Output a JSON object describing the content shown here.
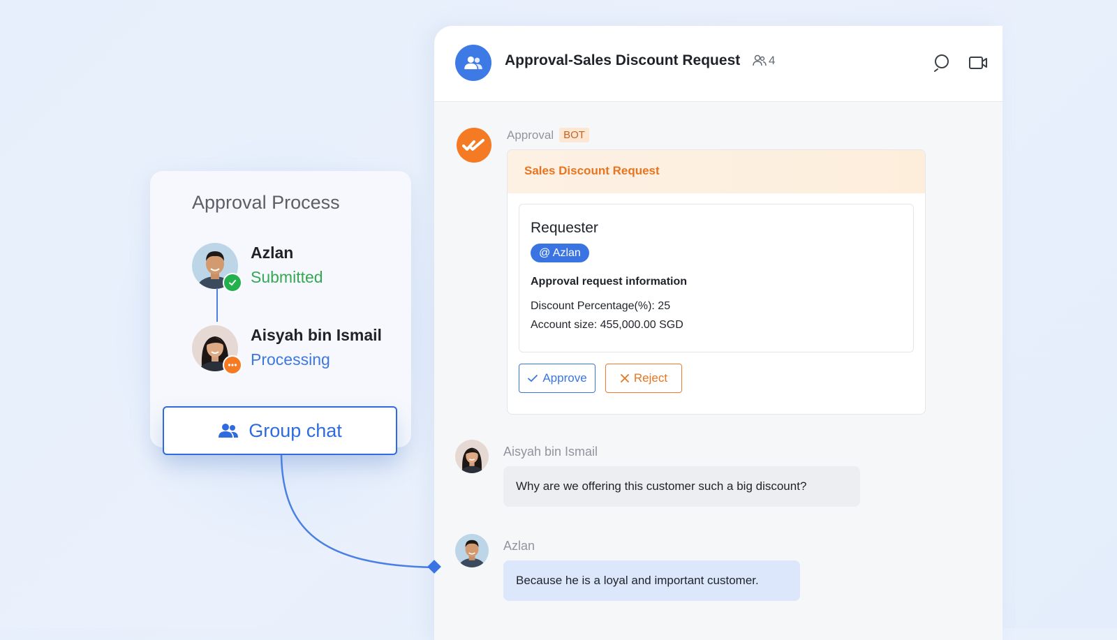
{
  "process": {
    "title": "Approval Process",
    "steps": [
      {
        "name": "Azlan",
        "status": "Submitted",
        "status_color": "#34a853",
        "badge_icon": "check-icon"
      },
      {
        "name": "Aisyah bin Ismail",
        "status": "Processing",
        "status_color": "#3c78e0",
        "badge_icon": "more-dots-icon"
      }
    ],
    "group_chat_label": "Group chat"
  },
  "chat": {
    "title": "Approval-Sales Discount Request",
    "member_count": "4",
    "bot": {
      "sender": "Approval",
      "badge": "BOT",
      "card": {
        "title": "Sales Discount Request",
        "requester_label": "Requester",
        "requester_mention": "@ Azlan",
        "info_heading": "Approval request information",
        "info_lines": [
          "Discount Percentage(%): 25",
          "Account size: 455,000.00 SGD"
        ],
        "approve_label": "Approve",
        "reject_label": "Reject"
      }
    },
    "messages": [
      {
        "sender": "Aisyah bin Ismail",
        "text": "Why are we offering this customer such a big discount?"
      },
      {
        "sender": "Azlan",
        "text": "Because he is a loyal and important customer."
      }
    ]
  },
  "colors": {
    "primary": "#2f6bde",
    "bot_orange": "#f57a24",
    "success": "#22b14c"
  }
}
